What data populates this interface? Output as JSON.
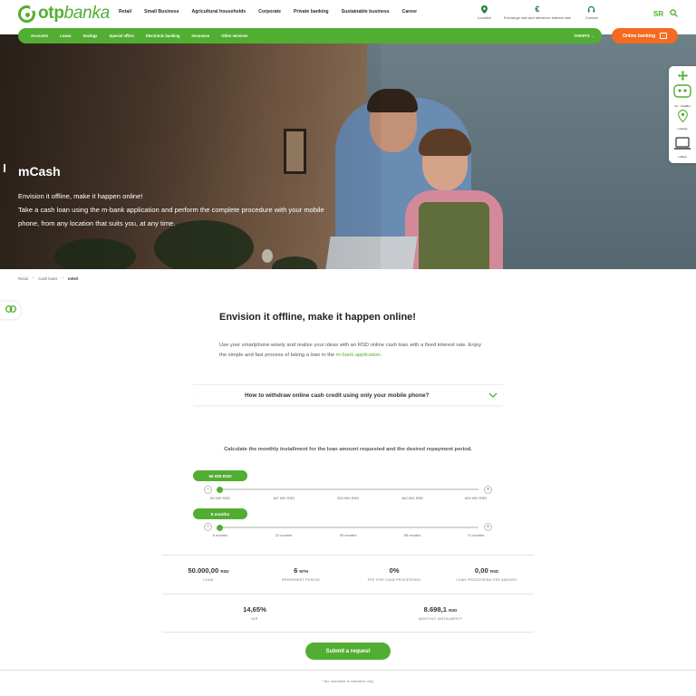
{
  "header": {
    "logo_text_bold": "otp",
    "logo_text_light": "banka",
    "nav": [
      "Retail",
      "Small Business",
      "Agricultural households",
      "Corporate",
      "Private banking",
      "Sustainable business",
      "Career"
    ],
    "util": [
      {
        "icon": "location-pin-icon",
        "label": "Location"
      },
      {
        "icon": "euro-icon",
        "label": "Exchange rate and reference interest rate"
      },
      {
        "icon": "headset-icon",
        "label": "Contact"
      }
    ],
    "lang": "SR"
  },
  "subnav": {
    "items": [
      "Accounts",
      "Loans",
      "Savings",
      "Special offers",
      "Electronic banking",
      "Insurance",
      "Other services"
    ],
    "tariffs": "TARIFFS",
    "online_banking": "Online banking"
  },
  "hero": {
    "title": "mCash",
    "line1": "Envision it offline, make it happen online!",
    "line2": "Take a cash loan using the m-bank application and perform the complete procedure with your mobile phone, from any location that suits you, at any time."
  },
  "side_widgets": [
    {
      "icon": "move-arrows-icon",
      "label": ""
    },
    {
      "icon": "chatbot-icon",
      "label": "Viv - ChatBot"
    },
    {
      "icon": "location-pin-icon",
      "label": "Lokacije"
    },
    {
      "icon": "laptop-icon",
      "label": "e-Bank"
    }
  ],
  "breadcrumb": [
    "Retail",
    "Cash loans",
    "mKeš"
  ],
  "content": {
    "heading": "Envision it offline, make it happen online!",
    "lead_text": "Use your smartphone wisely and realize your ideas with an RSD online cash loan with a fixed interest rate. Enjoy the simple and fast process of taking a loan in the",
    "lead_link": "m-bank application.",
    "accordion_question": "How to withdraw online cash credit using only your mobile phone?"
  },
  "calculator": {
    "intro": "Calculate the monthly installment for the loan amount requested and the desired repayment period.",
    "amount": {
      "label": "50 000 RSD",
      "ticks": [
        "50 000 RSD",
        "187 500 RSD",
        "325 000 RSD",
        "462 500 RSD",
        "600 000 RSD"
      ],
      "position": 0
    },
    "period": {
      "label": "6 months",
      "ticks": [
        "6 months",
        "22 months",
        "39 months",
        "55 months",
        "71 months"
      ],
      "position": 0
    },
    "stats_row1": [
      {
        "value": "50.000,00",
        "unit": "RSD",
        "key": "LOAN"
      },
      {
        "value": "6",
        "unit": "MTH",
        "key": "REPAYMENT PERIOD"
      },
      {
        "value": "0%",
        "unit": "",
        "key": "FEE FOR LOAN PROCESSING"
      },
      {
        "value": "0,00",
        "unit": "RSD",
        "key": "LOAN PROCESSING FEE AMOUNT"
      }
    ],
    "stats_row2": [
      {
        "value": "14,65%",
        "unit": "",
        "key": "NIR"
      },
      {
        "value": "8.698,1",
        "unit": "RSD",
        "key": "MONTHLY INSTALMENT*"
      }
    ],
    "submit": "Submit a request",
    "footnote": "* the calculator is indicative only."
  },
  "colors": {
    "brand_green": "#52ae32",
    "accent_orange": "#f26b21"
  }
}
